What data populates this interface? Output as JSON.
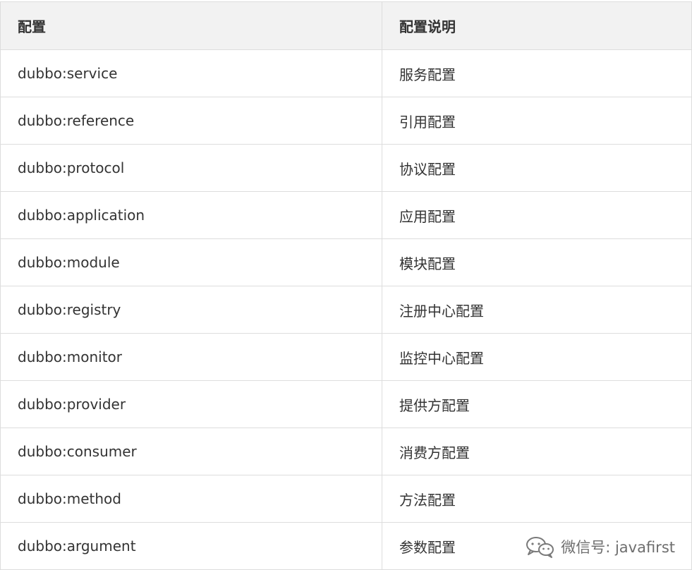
{
  "table": {
    "headers": [
      "配置",
      "配置说明"
    ],
    "rows": [
      [
        "dubbo:service",
        "服务配置"
      ],
      [
        "dubbo:reference",
        "引用配置"
      ],
      [
        "dubbo:protocol",
        "协议配置"
      ],
      [
        "dubbo:application",
        "应用配置"
      ],
      [
        "dubbo:module",
        "模块配置"
      ],
      [
        "dubbo:registry",
        "注册中心配置"
      ],
      [
        "dubbo:monitor",
        "监控中心配置"
      ],
      [
        "dubbo:provider",
        "提供方配置"
      ],
      [
        "dubbo:consumer",
        "消费方配置"
      ],
      [
        "dubbo:method",
        "方法配置"
      ],
      [
        "dubbo:argument",
        "参数配置"
      ]
    ]
  },
  "watermark": {
    "icon": "wechat-icon",
    "text": "微信号: javafirst"
  }
}
